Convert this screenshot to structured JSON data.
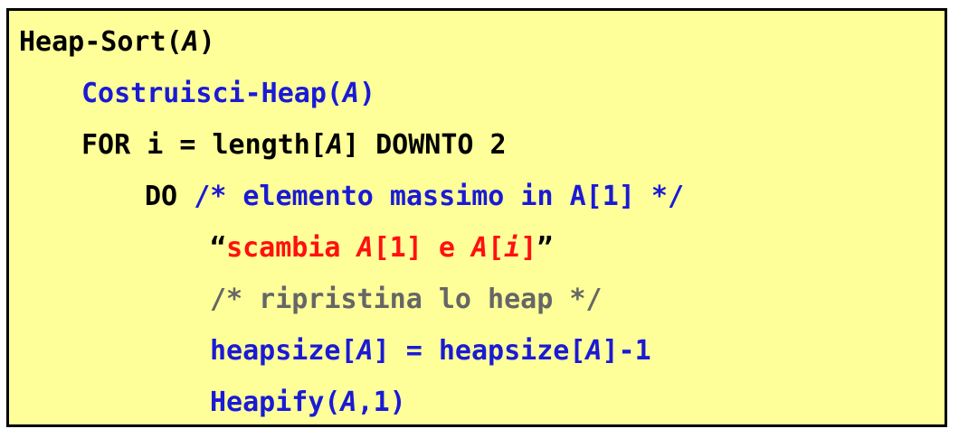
{
  "code": {
    "line1": {
      "name": "Heap-Sort(",
      "arg": "A",
      "close": ")"
    },
    "line2": {
      "name": "Costruisci-Heap(",
      "arg": "A",
      "close": ")"
    },
    "line3": {
      "pre": "FOR i = length[",
      "arg": "A",
      "post": "] DOWNTO 2"
    },
    "line4": {
      "keyword": "DO",
      "comment": "/* elemento massimo in A[1] */"
    },
    "line5": {
      "open_quote": "“",
      "text1": "scambia ",
      "a1": "A",
      "text2": "[1] e ",
      "a2": "A",
      "text3": "[",
      "i": "i",
      "text4": "]",
      "close_quote": "”"
    },
    "line6": {
      "comment": "/* ripristina lo heap */"
    },
    "line7": {
      "pre": "heapsize[",
      "a1": "A",
      "mid": "] = heapsize[",
      "a2": "A",
      "post": "]-1"
    },
    "line8": {
      "pre": "Heapify(",
      "arg": "A",
      "post": ",1)"
    }
  },
  "colors": {
    "background": "#ffff99",
    "border": "#000000",
    "keyword": "#000000",
    "call": "#1a1ad6",
    "swap": "#ff1010",
    "comment": "#666666"
  }
}
